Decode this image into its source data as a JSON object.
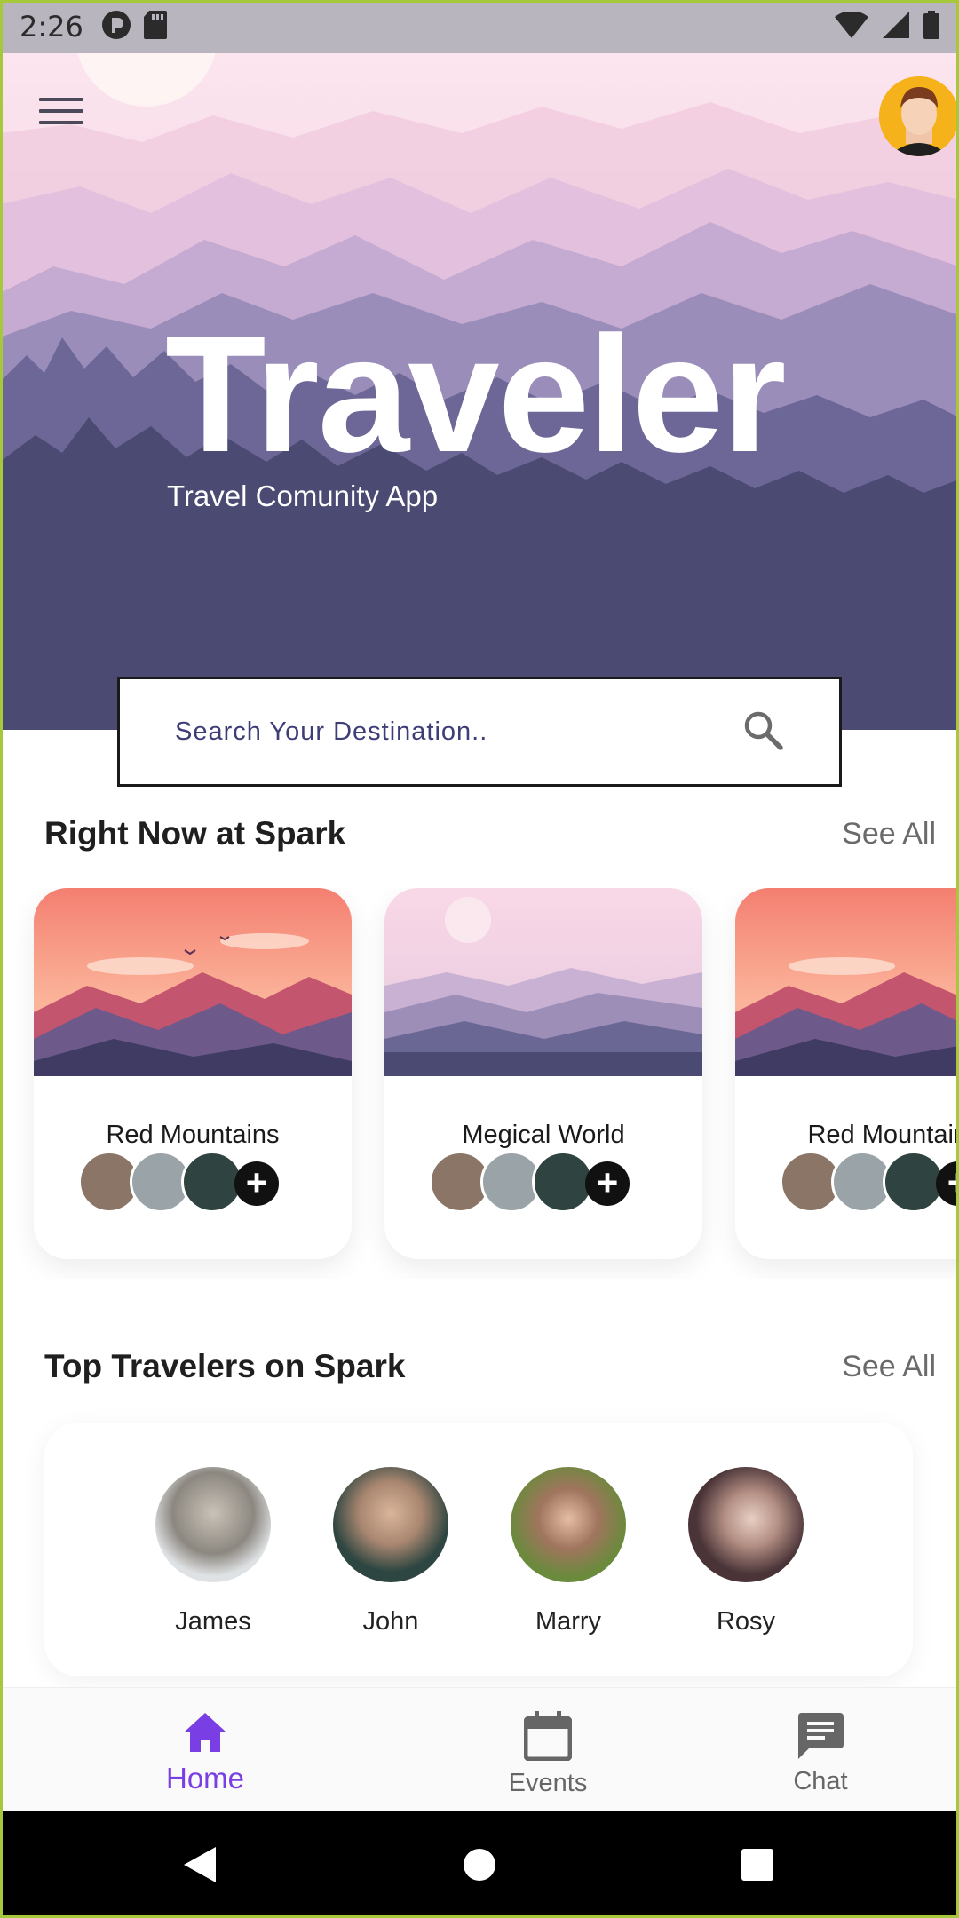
{
  "status_bar": {
    "time": "2:26",
    "left_icons": [
      "pocket-casts-icon",
      "sd-card-icon"
    ],
    "right_icons": [
      "wifi-icon",
      "cellular-signal-icon",
      "battery-icon"
    ]
  },
  "hero": {
    "menu_icon": "hamburger-menu-icon",
    "avatar_icon": "profile-avatar",
    "title": "Traveler",
    "subtitle": "Travel Comunity App"
  },
  "search": {
    "placeholder": "Search Your Destination..",
    "value": "",
    "icon": "search-icon"
  },
  "right_now": {
    "title": "Right Now at Spark",
    "see_all": "See All",
    "cards": [
      {
        "name": "Red Mountains",
        "image": "sunset-mountains"
      },
      {
        "name": "Megical World",
        "image": "misty-mountains"
      },
      {
        "name": "Red Mountains",
        "image": "sunset-mountains"
      }
    ]
  },
  "top_travelers": {
    "title": "Top Travelers on Spark",
    "see_all": "See All",
    "people": [
      {
        "name": "James"
      },
      {
        "name": "John"
      },
      {
        "name": "Marry"
      },
      {
        "name": "Rosy"
      }
    ]
  },
  "bottom_nav": {
    "items": [
      {
        "label": "Home",
        "icon": "home-icon",
        "active": true
      },
      {
        "label": "Events",
        "icon": "calendar-icon",
        "active": false
      },
      {
        "label": "Chat",
        "icon": "chat-icon",
        "active": false
      }
    ],
    "active_color": "#7a3fe4"
  },
  "system_nav": {
    "icons": [
      "back-icon",
      "home-circle-icon",
      "recents-icon"
    ]
  },
  "colors": {
    "hero_dark": "#4a4a72",
    "accent": "#7a3fe4",
    "avatar_bg": "#f6b21a"
  }
}
